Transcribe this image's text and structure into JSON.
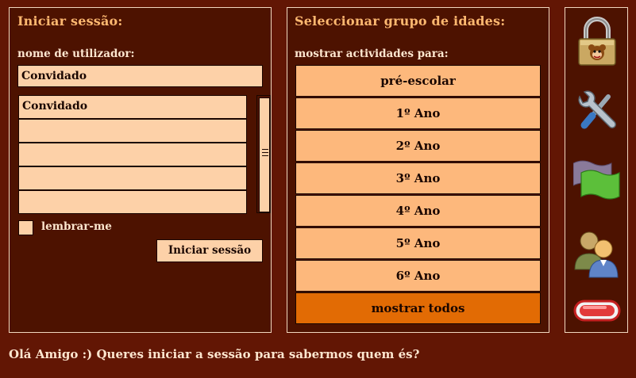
{
  "login": {
    "heading": "Iniciar sessão:",
    "username_label": "nome de utilizador:",
    "username_value": "Convidado",
    "user_list": [
      "Convidado",
      "",
      "",
      "",
      ""
    ],
    "remember_label": "lembrar-me",
    "login_button": "Iniciar sessão"
  },
  "age_groups": {
    "heading": "Seleccionar grupo de idades:",
    "subheading": "mostrar actividades para:",
    "items": [
      "pré-escolar",
      "1º Ano",
      "2º Ano",
      "3º Ano",
      "4º Ano",
      "5º Ano",
      "6º Ano"
    ],
    "show_all": "mostrar todos"
  },
  "sidebar": {
    "icons": [
      "padlock-icon",
      "tools-icon",
      "flag-icon",
      "users-icon",
      "exit-icon"
    ]
  },
  "footer": {
    "message": "Olá Amigo :) Queres iniciar a sessão para sabermos quem és?"
  },
  "colors": {
    "background": "#621604",
    "panel": "#4d1200",
    "heading": "#fdb870",
    "field": "#fdd1a8",
    "age_button": "#fdb87c",
    "show_all_button": "#e26b04"
  }
}
